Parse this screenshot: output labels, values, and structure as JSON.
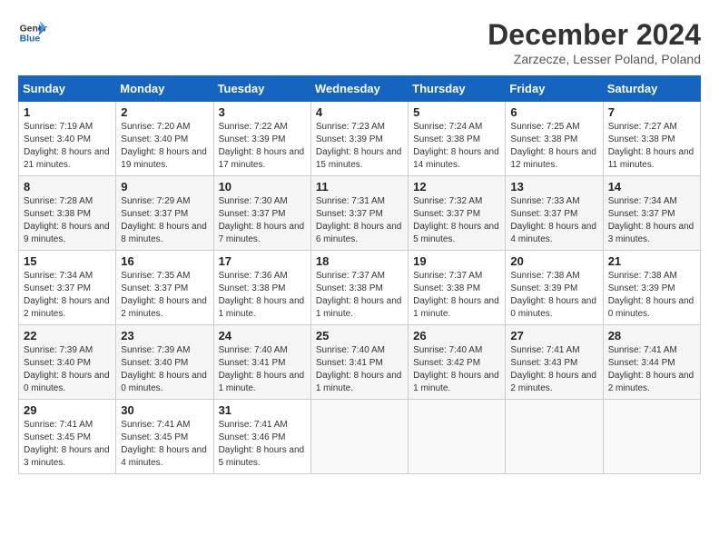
{
  "header": {
    "logo_line1": "General",
    "logo_line2": "Blue",
    "month_title": "December 2024",
    "subtitle": "Zarzecze, Lesser Poland, Poland"
  },
  "days_of_week": [
    "Sunday",
    "Monday",
    "Tuesday",
    "Wednesday",
    "Thursday",
    "Friday",
    "Saturday"
  ],
  "weeks": [
    [
      {
        "day": "1",
        "info": "Sunrise: 7:19 AM\nSunset: 3:40 PM\nDaylight: 8 hours and 21 minutes."
      },
      {
        "day": "2",
        "info": "Sunrise: 7:20 AM\nSunset: 3:40 PM\nDaylight: 8 hours and 19 minutes."
      },
      {
        "day": "3",
        "info": "Sunrise: 7:22 AM\nSunset: 3:39 PM\nDaylight: 8 hours and 17 minutes."
      },
      {
        "day": "4",
        "info": "Sunrise: 7:23 AM\nSunset: 3:39 PM\nDaylight: 8 hours and 15 minutes."
      },
      {
        "day": "5",
        "info": "Sunrise: 7:24 AM\nSunset: 3:38 PM\nDaylight: 8 hours and 14 minutes."
      },
      {
        "day": "6",
        "info": "Sunrise: 7:25 AM\nSunset: 3:38 PM\nDaylight: 8 hours and 12 minutes."
      },
      {
        "day": "7",
        "info": "Sunrise: 7:27 AM\nSunset: 3:38 PM\nDaylight: 8 hours and 11 minutes."
      }
    ],
    [
      {
        "day": "8",
        "info": "Sunrise: 7:28 AM\nSunset: 3:38 PM\nDaylight: 8 hours and 9 minutes."
      },
      {
        "day": "9",
        "info": "Sunrise: 7:29 AM\nSunset: 3:37 PM\nDaylight: 8 hours and 8 minutes."
      },
      {
        "day": "10",
        "info": "Sunrise: 7:30 AM\nSunset: 3:37 PM\nDaylight: 8 hours and 7 minutes."
      },
      {
        "day": "11",
        "info": "Sunrise: 7:31 AM\nSunset: 3:37 PM\nDaylight: 8 hours and 6 minutes."
      },
      {
        "day": "12",
        "info": "Sunrise: 7:32 AM\nSunset: 3:37 PM\nDaylight: 8 hours and 5 minutes."
      },
      {
        "day": "13",
        "info": "Sunrise: 7:33 AM\nSunset: 3:37 PM\nDaylight: 8 hours and 4 minutes."
      },
      {
        "day": "14",
        "info": "Sunrise: 7:34 AM\nSunset: 3:37 PM\nDaylight: 8 hours and 3 minutes."
      }
    ],
    [
      {
        "day": "15",
        "info": "Sunrise: 7:34 AM\nSunset: 3:37 PM\nDaylight: 8 hours and 2 minutes."
      },
      {
        "day": "16",
        "info": "Sunrise: 7:35 AM\nSunset: 3:37 PM\nDaylight: 8 hours and 2 minutes."
      },
      {
        "day": "17",
        "info": "Sunrise: 7:36 AM\nSunset: 3:38 PM\nDaylight: 8 hours and 1 minute."
      },
      {
        "day": "18",
        "info": "Sunrise: 7:37 AM\nSunset: 3:38 PM\nDaylight: 8 hours and 1 minute."
      },
      {
        "day": "19",
        "info": "Sunrise: 7:37 AM\nSunset: 3:38 PM\nDaylight: 8 hours and 1 minute."
      },
      {
        "day": "20",
        "info": "Sunrise: 7:38 AM\nSunset: 3:39 PM\nDaylight: 8 hours and 0 minutes."
      },
      {
        "day": "21",
        "info": "Sunrise: 7:38 AM\nSunset: 3:39 PM\nDaylight: 8 hours and 0 minutes."
      }
    ],
    [
      {
        "day": "22",
        "info": "Sunrise: 7:39 AM\nSunset: 3:40 PM\nDaylight: 8 hours and 0 minutes."
      },
      {
        "day": "23",
        "info": "Sunrise: 7:39 AM\nSunset: 3:40 PM\nDaylight: 8 hours and 0 minutes."
      },
      {
        "day": "24",
        "info": "Sunrise: 7:40 AM\nSunset: 3:41 PM\nDaylight: 8 hours and 1 minute."
      },
      {
        "day": "25",
        "info": "Sunrise: 7:40 AM\nSunset: 3:41 PM\nDaylight: 8 hours and 1 minute."
      },
      {
        "day": "26",
        "info": "Sunrise: 7:40 AM\nSunset: 3:42 PM\nDaylight: 8 hours and 1 minute."
      },
      {
        "day": "27",
        "info": "Sunrise: 7:41 AM\nSunset: 3:43 PM\nDaylight: 8 hours and 2 minutes."
      },
      {
        "day": "28",
        "info": "Sunrise: 7:41 AM\nSunset: 3:44 PM\nDaylight: 8 hours and 2 minutes."
      }
    ],
    [
      {
        "day": "29",
        "info": "Sunrise: 7:41 AM\nSunset: 3:45 PM\nDaylight: 8 hours and 3 minutes."
      },
      {
        "day": "30",
        "info": "Sunrise: 7:41 AM\nSunset: 3:45 PM\nDaylight: 8 hours and 4 minutes."
      },
      {
        "day": "31",
        "info": "Sunrise: 7:41 AM\nSunset: 3:46 PM\nDaylight: 8 hours and 5 minutes."
      },
      {
        "day": "",
        "info": ""
      },
      {
        "day": "",
        "info": ""
      },
      {
        "day": "",
        "info": ""
      },
      {
        "day": "",
        "info": ""
      }
    ]
  ]
}
